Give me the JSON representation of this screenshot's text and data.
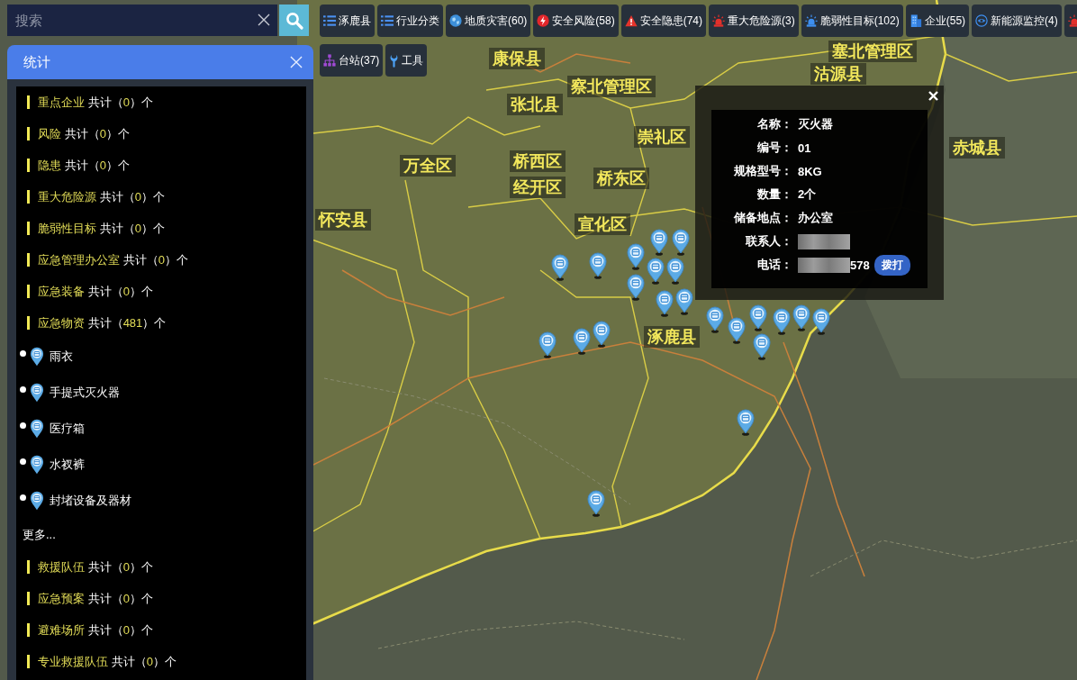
{
  "search": {
    "placeholder": "搜索"
  },
  "toolbar": {
    "top_row": [
      {
        "kind": "list",
        "label": "涿鹿县"
      },
      {
        "kind": "list",
        "label": "行业分类"
      },
      {
        "kind": "globe",
        "label": "地质灾害(60)"
      },
      {
        "kind": "bolt",
        "label": "安全风险(58)"
      },
      {
        "kind": "warning",
        "label": "安全隐患(74)"
      },
      {
        "kind": "siren",
        "label": "重大危险源(3)"
      },
      {
        "kind": "beacon",
        "label": "脆弱性目标(102)"
      },
      {
        "kind": "building",
        "label": "企业(55)"
      },
      {
        "kind": "eye",
        "label": "新能源监控(4)"
      },
      {
        "kind": "siren"
      }
    ],
    "second_row": [
      {
        "kind": "network",
        "label": "台站(37)"
      },
      {
        "kind": "wrench",
        "label": "工具"
      }
    ]
  },
  "stats_panel": {
    "title": "统计",
    "items": [
      {
        "kind": "category",
        "name": "重点企业",
        "tally": "共计（",
        "count": "0",
        "unit": "）个"
      },
      {
        "kind": "category",
        "name": "风险",
        "tally": "共计（",
        "count": "0",
        "unit": "）个"
      },
      {
        "kind": "category",
        "name": "隐患",
        "tally": "共计（",
        "count": "0",
        "unit": "）个"
      },
      {
        "kind": "category",
        "name": "重大危险源",
        "tally": "共计（",
        "count": "0",
        "unit": "）个"
      },
      {
        "kind": "category",
        "name": "脆弱性目标",
        "tally": "共计（",
        "count": "0",
        "unit": "）个"
      },
      {
        "kind": "category",
        "name": "应急管理办公室",
        "tally": "共计（",
        "count": "0",
        "unit": "）个"
      },
      {
        "kind": "category",
        "name": "应急装备",
        "tally": "共计（",
        "count": "0",
        "unit": "）个"
      },
      {
        "kind": "category",
        "name": "应急物资",
        "tally": "共计（",
        "count": "481",
        "unit": "）个"
      },
      {
        "kind": "material",
        "name": "雨衣"
      },
      {
        "kind": "material",
        "name": "手提式灭火器"
      },
      {
        "kind": "material",
        "name": "医疗箱"
      },
      {
        "kind": "material",
        "name": "水衩裤"
      },
      {
        "kind": "material",
        "name": "封堵设备及器材"
      },
      {
        "kind": "more",
        "name": "更多..."
      },
      {
        "kind": "category",
        "name": "救援队伍",
        "tally": "共计（",
        "count": "0",
        "unit": "）个"
      },
      {
        "kind": "category",
        "name": "应急预案",
        "tally": "共计（",
        "count": "0",
        "unit": "）个"
      },
      {
        "kind": "category",
        "name": "避难场所",
        "tally": "共计（",
        "count": "0",
        "unit": "）个"
      },
      {
        "kind": "category",
        "name": "专业救援队伍",
        "tally": "共计（",
        "count": "0",
        "unit": "）个"
      }
    ]
  },
  "map": {
    "places": [
      "康保县",
      "察北管理区",
      "张北县",
      "塞北管理区",
      "沽源县",
      "崇礼区",
      "赤城县",
      "万全区",
      "桥西区",
      "经开区",
      "桥东区",
      "怀安县",
      "宣化区",
      "涿鹿县"
    ]
  },
  "info_popup": {
    "fields": [
      {
        "label": "名称：",
        "value": "灭火器",
        "redacted": false
      },
      {
        "label": "编号：",
        "value": "01",
        "redacted": false
      },
      {
        "label": "规格型号：",
        "value": "8KG",
        "redacted": false
      },
      {
        "label": "数量：",
        "value": "2个",
        "redacted": false
      },
      {
        "label": "储备地点：",
        "value": "办公室",
        "redacted": false
      },
      {
        "label": "联系人：",
        "redacted": true
      },
      {
        "label": "电话：",
        "value": "578",
        "redacted": true,
        "action": "拨打"
      }
    ]
  }
}
